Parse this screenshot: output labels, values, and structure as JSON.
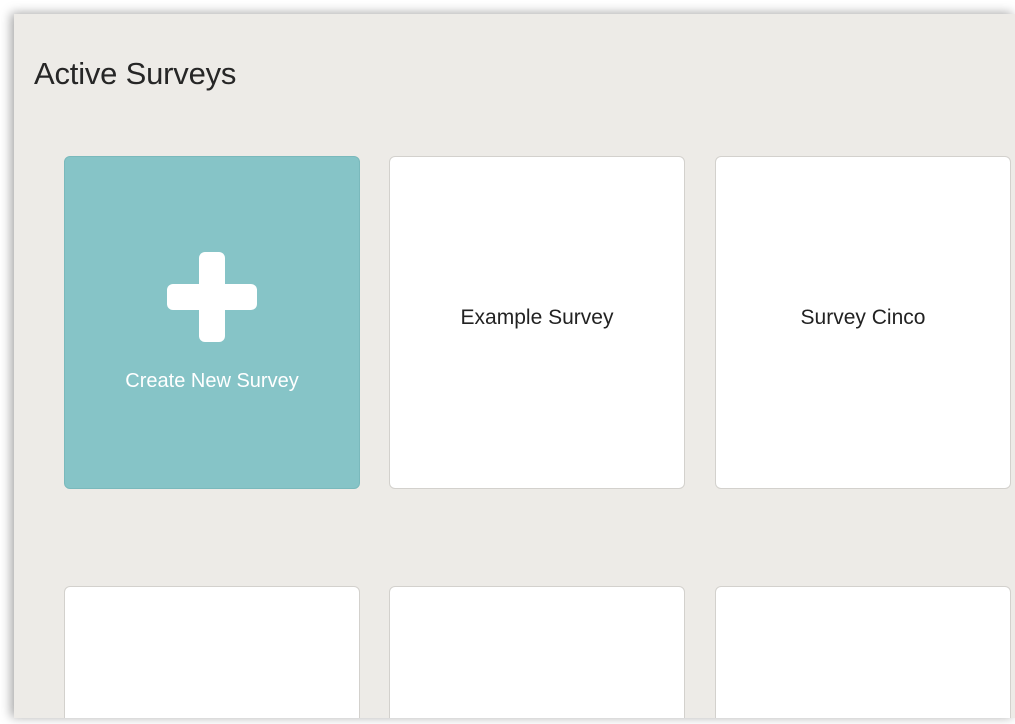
{
  "header": {
    "title": "Active Surveys"
  },
  "create_card": {
    "label": "Create New Survey",
    "icon": "plus-icon",
    "color": "#86c4c7"
  },
  "surveys": [
    {
      "label": "Example Survey"
    },
    {
      "label": "Survey Cinco"
    },
    {
      "label": ""
    },
    {
      "label": ""
    },
    {
      "label": ""
    }
  ]
}
